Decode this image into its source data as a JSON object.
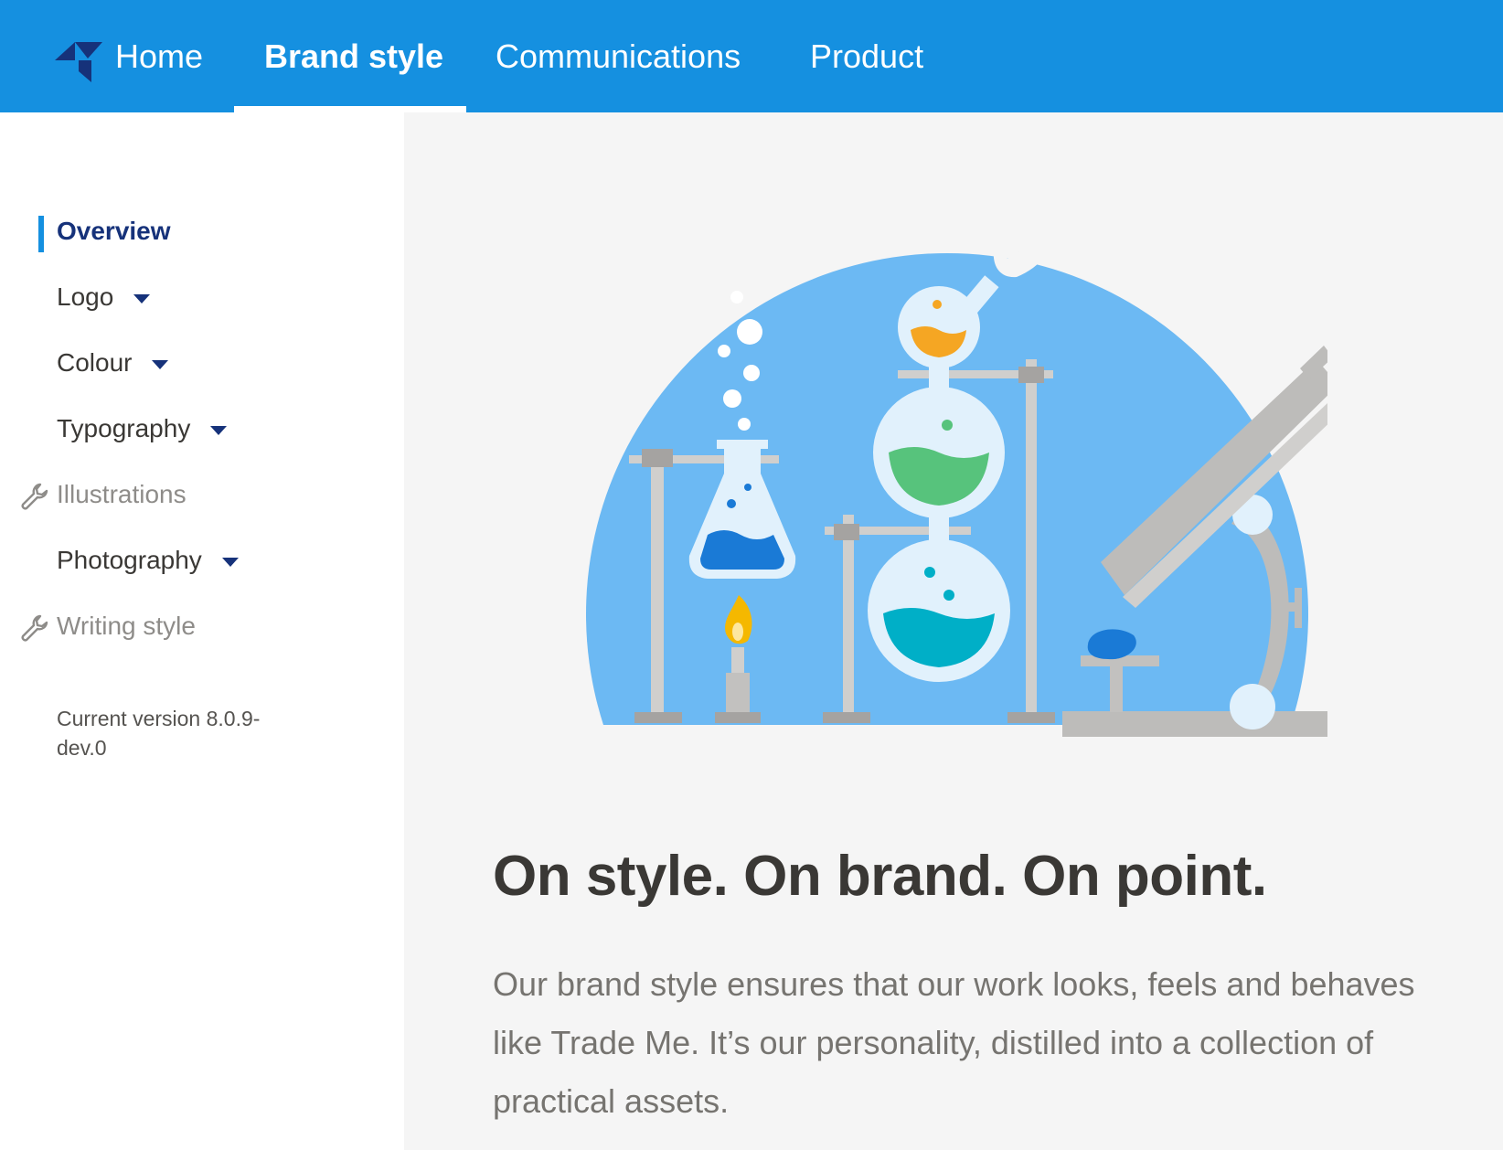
{
  "header": {
    "tabs": [
      {
        "label": "Home",
        "active": false
      },
      {
        "label": "Brand style",
        "active": true
      },
      {
        "label": "Communications",
        "active": false
      },
      {
        "label": "Product",
        "active": false
      }
    ],
    "brand_color": "#1590e0"
  },
  "sidebar": {
    "items": [
      {
        "label": "Overview",
        "state": "active"
      },
      {
        "label": "Logo",
        "state": "expandable"
      },
      {
        "label": "Colour",
        "state": "expandable"
      },
      {
        "label": "Typography",
        "state": "expandable"
      },
      {
        "label": "Illustrations",
        "state": "in-progress",
        "icon": "wrench-icon"
      },
      {
        "label": "Photography",
        "state": "expandable"
      },
      {
        "label": "Writing style",
        "state": "in-progress",
        "icon": "wrench-icon"
      }
    ],
    "version": "Current version 8.0.9-dev.0"
  },
  "main": {
    "hero_illustration": "laboratory-illustration",
    "headline": "On style. On brand. On point.",
    "lead": "Our brand style ensures that our work looks, feels and behaves like Trade Me. It’s our personality, distilled into a collection of practical assets."
  },
  "colors": {
    "accent": "#1590e0",
    "nav_active": "#16327a",
    "heading": "#3a3835",
    "body_text": "#767470",
    "muted": "#8e8c89"
  }
}
